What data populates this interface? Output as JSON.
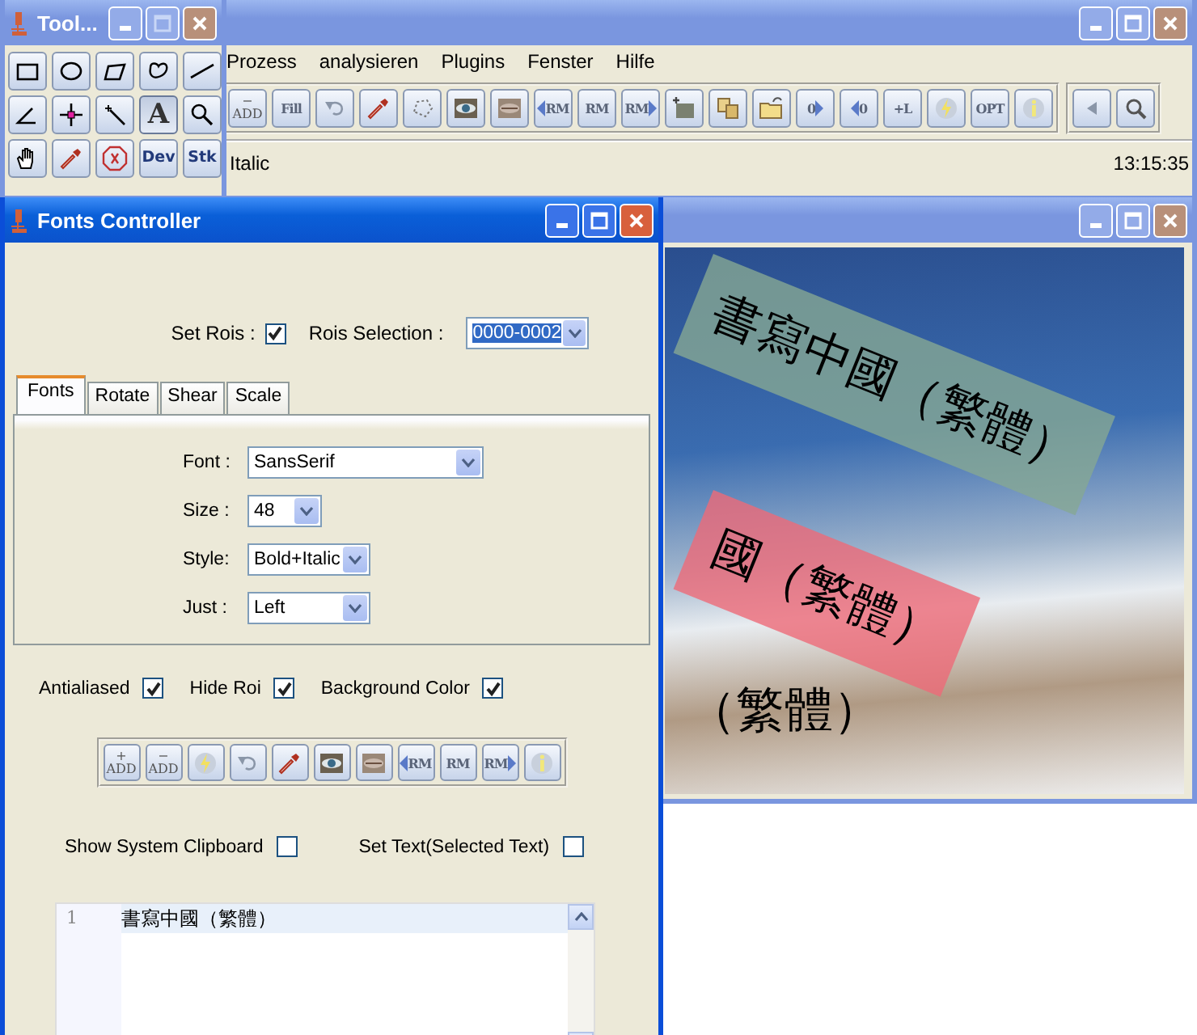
{
  "main_window": {
    "active": false,
    "menu": [
      "Prozess",
      "analysieren",
      "Plugins",
      "Fenster",
      "Hilfe"
    ],
    "toolbar": [
      {
        "kind": "add",
        "sign": "−",
        "label": "ADD"
      },
      {
        "kind": "text",
        "label": "Fill"
      },
      {
        "kind": "undo"
      },
      {
        "kind": "dropper"
      },
      {
        "kind": "dotpoly"
      },
      {
        "kind": "eye"
      },
      {
        "kind": "lips"
      },
      {
        "kind": "rm-left",
        "label": "RM"
      },
      {
        "kind": "text",
        "label": "RM"
      },
      {
        "kind": "rm-right",
        "label": "RM"
      },
      {
        "kind": "camera"
      },
      {
        "kind": "copy"
      },
      {
        "kind": "folder"
      },
      {
        "kind": "zero-right",
        "label": "0"
      },
      {
        "kind": "zero-left",
        "label": "0"
      },
      {
        "kind": "text",
        "label": "+L"
      },
      {
        "kind": "lightning"
      },
      {
        "kind": "text",
        "label": "OPT"
      },
      {
        "kind": "info"
      }
    ],
    "extra_buttons": [
      {
        "kind": "left"
      },
      {
        "kind": "zoomgrey"
      }
    ],
    "status": "Italic",
    "clock": "13:15:35"
  },
  "tools_window": {
    "title": "Tool...",
    "active": false,
    "tools": [
      {
        "kind": "rect",
        "selected": false
      },
      {
        "kind": "oval",
        "selected": false
      },
      {
        "kind": "polygon",
        "selected": false
      },
      {
        "kind": "freehand",
        "selected": false
      },
      {
        "kind": "line",
        "selected": false
      },
      {
        "kind": "angle",
        "selected": false
      },
      {
        "kind": "point",
        "selected": false
      },
      {
        "kind": "wand",
        "selected": false
      },
      {
        "kind": "bigtext",
        "label": "A",
        "selected": true
      },
      {
        "kind": "zoom",
        "selected": false
      },
      {
        "kind": "hand",
        "selected": false
      },
      {
        "kind": "dropper",
        "selected": false
      },
      {
        "kind": "stop",
        "selected": false
      },
      {
        "kind": "text",
        "label": "Dev",
        "selected": false
      },
      {
        "kind": "text",
        "label": "Stk",
        "selected": false
      }
    ]
  },
  "image_window": {
    "active": false,
    "overlays": [
      {
        "kind": "band",
        "text": "書寫中國（繁體）",
        "color": "#86a894"
      },
      {
        "kind": "band",
        "text": "國（繁體）",
        "color": "#ee6a78"
      },
      {
        "kind": "plain",
        "text": "（繁體）"
      }
    ]
  },
  "fonts_window": {
    "title": "Fonts Controller",
    "active": true,
    "set_rois": {
      "label": "Set Rois :",
      "checked": true
    },
    "rois_selection": {
      "label": "Rois Selection :",
      "value": "0000-0002"
    },
    "tabs": [
      {
        "label": "Fonts",
        "selected": true
      },
      {
        "label": "Rotate",
        "selected": false
      },
      {
        "label": "Shear",
        "selected": false
      },
      {
        "label": "Scale",
        "selected": false
      }
    ],
    "fields": [
      {
        "label": "Font :",
        "value": "SansSerif",
        "kind": "wide"
      },
      {
        "label": "Size :",
        "value": "48",
        "kind": "narrow"
      },
      {
        "label": "Style:",
        "value": "Bold+Italic",
        "kind": "medium"
      },
      {
        "label": "Just :",
        "value": "Left",
        "kind": "medium"
      }
    ],
    "options": [
      {
        "label": "Antialiased",
        "checked": true
      },
      {
        "label": "Hide Roi",
        "checked": true
      },
      {
        "label": "Background Color",
        "checked": true
      }
    ],
    "toolbar": [
      {
        "kind": "add",
        "sign": "+",
        "label": "ADD"
      },
      {
        "kind": "add",
        "sign": "−",
        "label": "ADD"
      },
      {
        "kind": "lightning"
      },
      {
        "kind": "undo"
      },
      {
        "kind": "dropper"
      },
      {
        "kind": "eye"
      },
      {
        "kind": "lips"
      },
      {
        "kind": "rm-left",
        "label": "RM"
      },
      {
        "kind": "text",
        "label": "RM"
      },
      {
        "kind": "rm-right",
        "label": "RM"
      },
      {
        "kind": "info"
      }
    ],
    "clipboard_options": [
      {
        "label": "Show System Clipboard",
        "checked": false
      },
      {
        "label": "Set Text(Selected Text)",
        "checked": false
      }
    ],
    "editor": {
      "line_number": "1",
      "text": "書寫中國（繁體）"
    }
  }
}
